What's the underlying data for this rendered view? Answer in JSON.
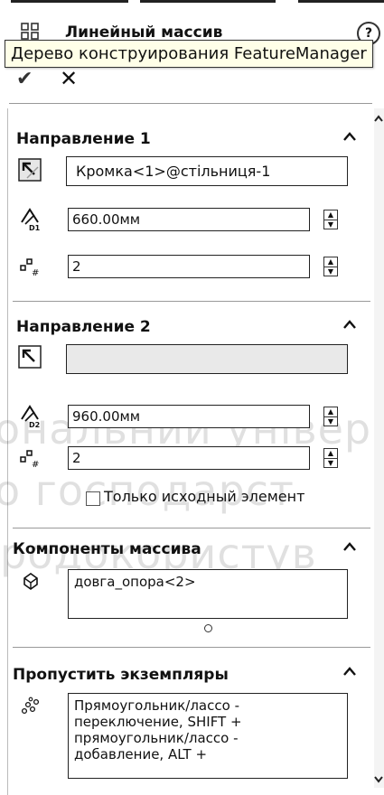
{
  "header": {
    "title": "Линейный массив",
    "tooltip": "Дерево конструирования FeatureManager",
    "help_glyph": "?",
    "ok_glyph": "✔",
    "cancel_glyph": "✕"
  },
  "direction1": {
    "title": "Направление 1",
    "edge_value": "Кромка<1>@стільниця-1",
    "distance_value": "660.00мм",
    "count_value": "2",
    "distance_badge": "D1"
  },
  "direction2": {
    "title": "Направление 2",
    "edge_value": "",
    "distance_value": "960.00мм",
    "count_value": "2",
    "distance_badge": "D2",
    "only_seed_label": "Только исходный элемент",
    "only_seed_checked": false
  },
  "components": {
    "title": "Компоненты массива",
    "item": "довга_опора<2>"
  },
  "skip": {
    "title": "Пропустить экземпляры",
    "hint_lines": [
      "Прямоугольник/лассо -",
      "переключение, SHIFT +",
      "прямоугольник/лассо -",
      "добавление, ALT +"
    ]
  },
  "watermark": {
    "lines": [
      "ональний універ",
      "о господарст",
      "родокористув"
    ]
  },
  "colors": {
    "accent": "#333333",
    "field_border": "#222222",
    "disabled_field": "#e9e9e9",
    "tooltip_bg": "#ffffe8"
  }
}
